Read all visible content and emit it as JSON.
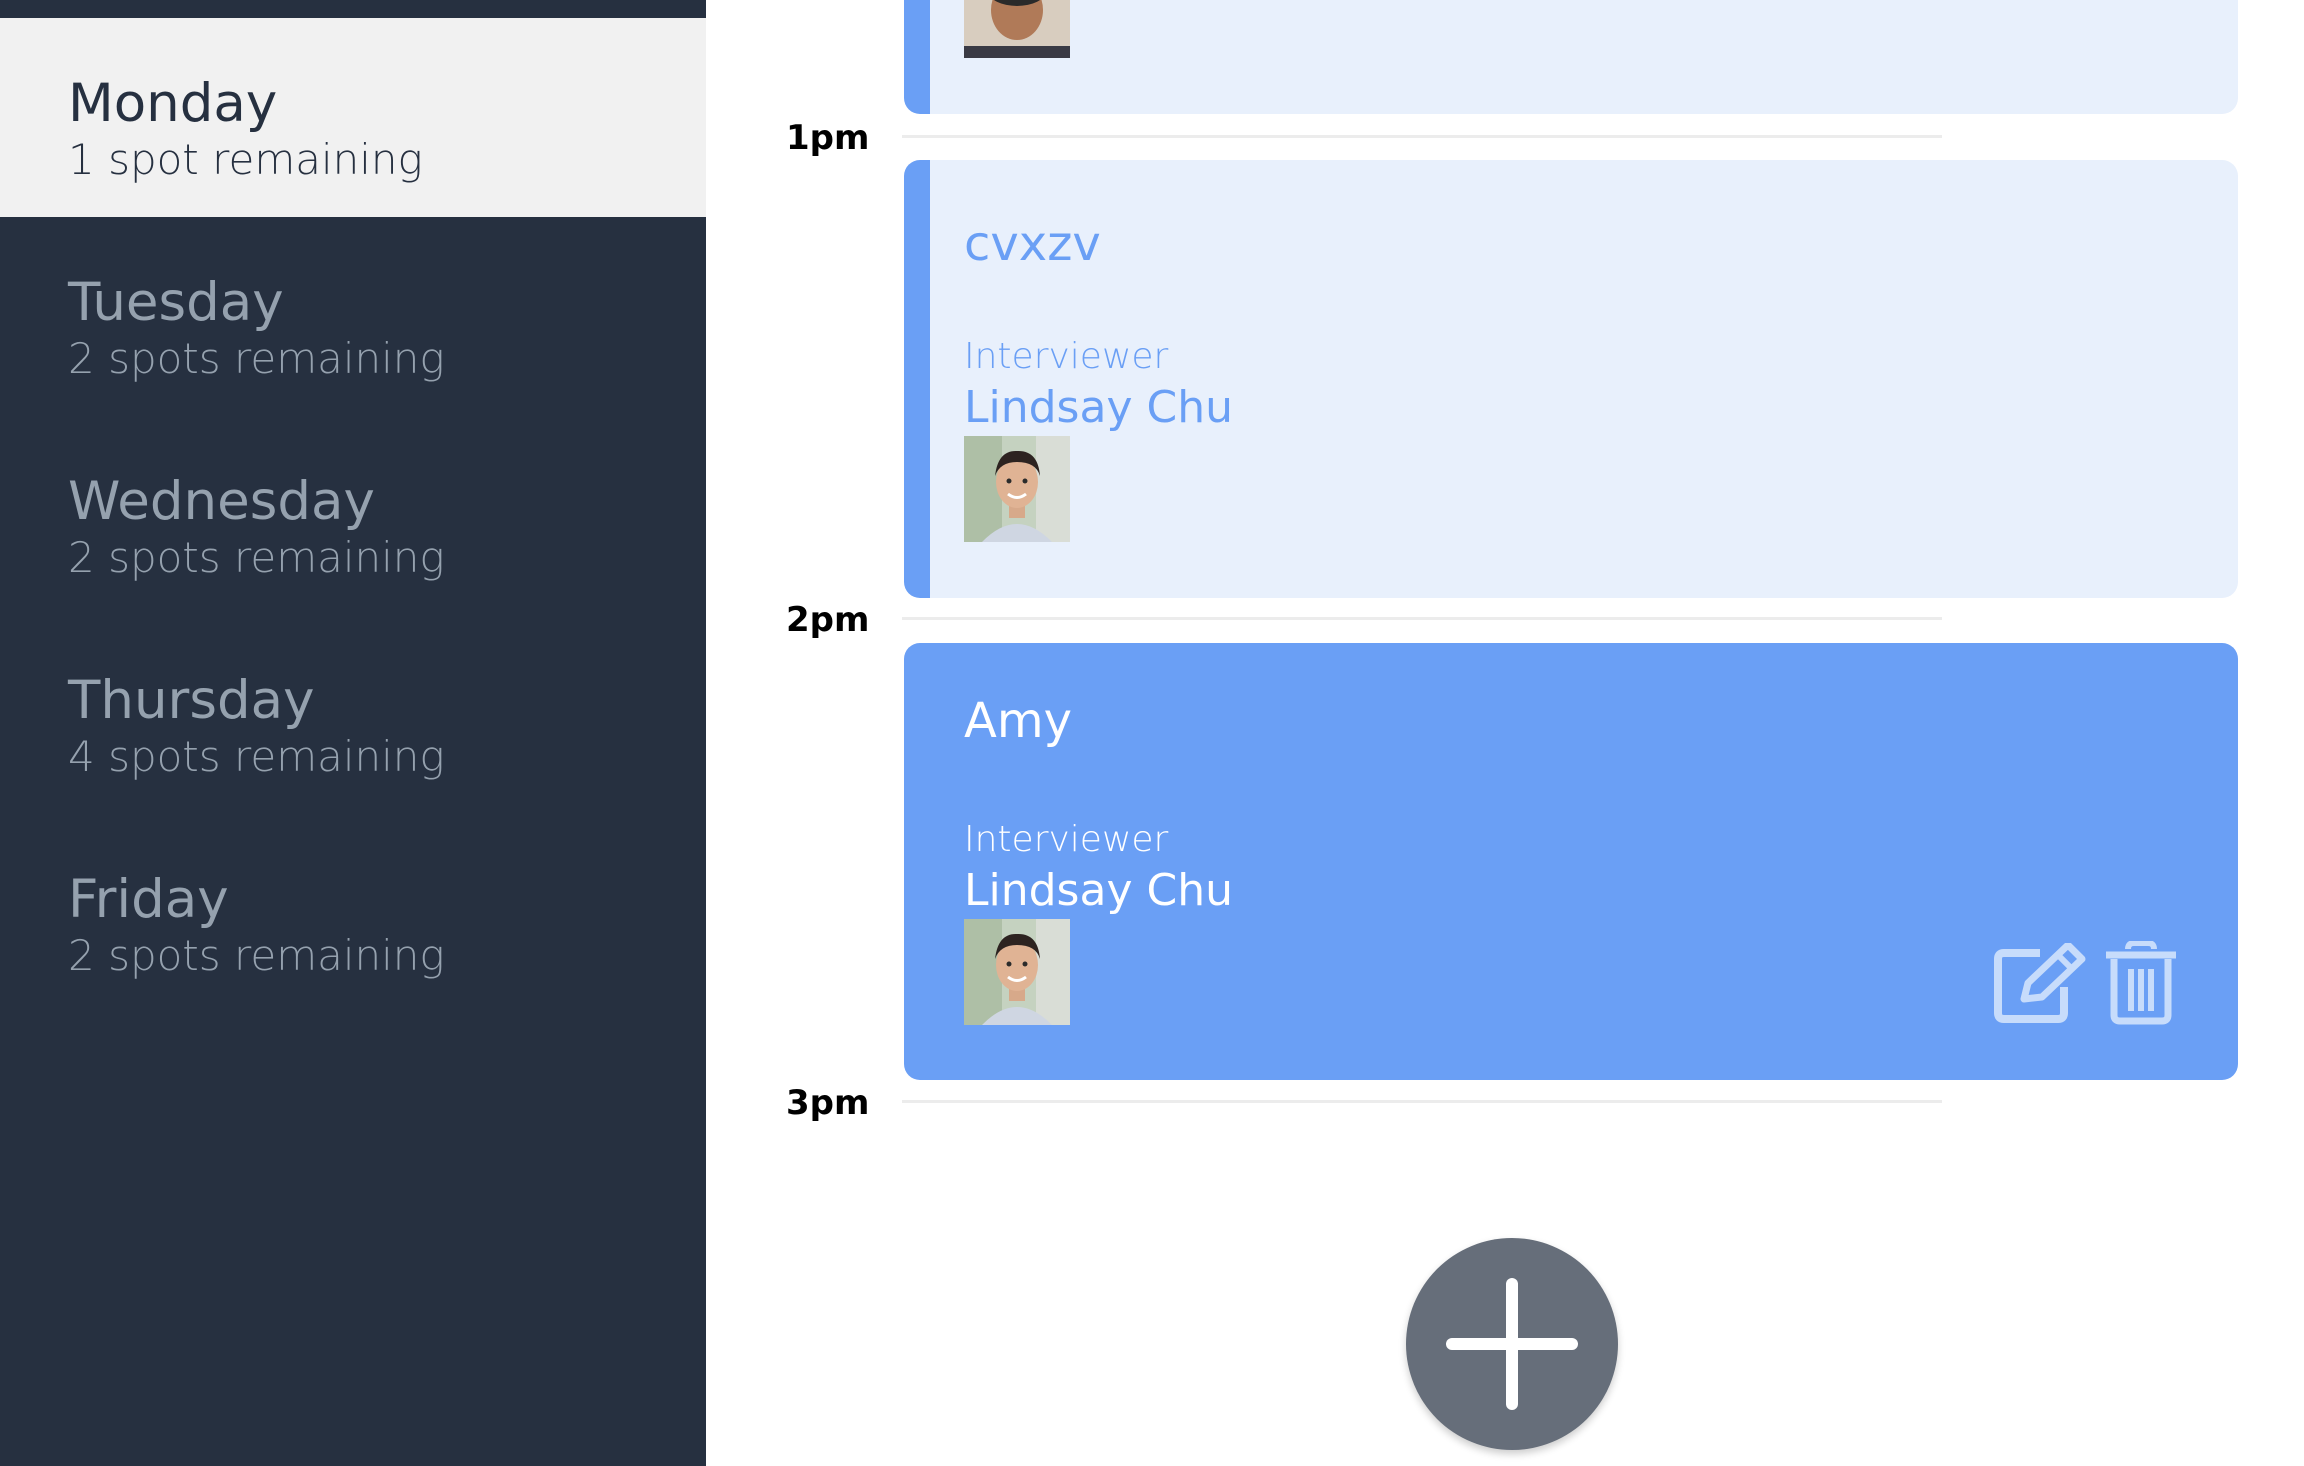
{
  "sidebar": {
    "days": [
      {
        "name": "Monday",
        "spots": "1 spot remaining",
        "active": true
      },
      {
        "name": "Tuesday",
        "spots": "2 spots remaining",
        "active": false
      },
      {
        "name": "Wednesday",
        "spots": "2 spots remaining",
        "active": false
      },
      {
        "name": "Thursday",
        "spots": "4 spots remaining",
        "active": false
      },
      {
        "name": "Friday",
        "spots": "2 spots remaining",
        "active": false
      }
    ]
  },
  "schedule": {
    "times": [
      "1pm",
      "2pm",
      "3pm"
    ],
    "appointments": [
      {
        "title": "",
        "interviewer_label": "",
        "interviewer_name": "",
        "avatar": "avatar-photo"
      },
      {
        "title": "cvxzv",
        "interviewer_label": "Interviewer",
        "interviewer_name": "Lindsay Chu",
        "avatar": "avatar-photo"
      },
      {
        "title": "Amy",
        "interviewer_label": "Interviewer",
        "interviewer_name": "Lindsay Chu",
        "avatar": "avatar-photo",
        "selected": true
      }
    ]
  },
  "icons": {
    "edit": "edit-icon",
    "delete": "trash-icon",
    "add": "plus-icon"
  },
  "colors": {
    "sidebar_bg": "#263040",
    "sidebar_active_bg": "#f1f1f1",
    "accent": "#6a9ff5",
    "card_bg": "#e8f0fc",
    "fab_bg": "#666e7a"
  }
}
